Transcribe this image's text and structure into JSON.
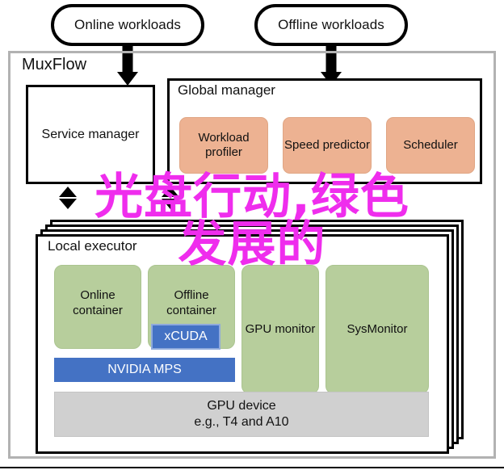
{
  "figure": {
    "outer_container": {
      "label": "MuxFlow",
      "border_color": "#b2b2b2"
    },
    "watermark": {
      "text": "光盘行动,绿色\n发展的",
      "color": "#ef2ded"
    }
  },
  "workloads": [
    {
      "id": "online-workloads",
      "label": "Online workloads"
    },
    {
      "id": "offline-workloads",
      "label": "Offline workloads"
    }
  ],
  "service_manager": {
    "label": "Service manager"
  },
  "global_manager": {
    "label": "Global manager",
    "accent_color": "#edb292",
    "components": [
      {
        "id": "workload-profiler",
        "label": "Workload profiler"
      },
      {
        "id": "speed-predictor",
        "label": "Speed predictor"
      },
      {
        "id": "scheduler",
        "label": "Scheduler"
      }
    ]
  },
  "local_executor": {
    "label": "Local executor",
    "accent_color": "#b7ce9c",
    "stack_layers": 4,
    "containers": [
      {
        "id": "online-container",
        "label": "Online container"
      },
      {
        "id": "offline-container",
        "label": "Offline container"
      },
      {
        "id": "gpu-monitor",
        "label": "GPU monitor"
      },
      {
        "id": "sysmonitor",
        "label": "SysMonitor"
      }
    ],
    "xcuda": {
      "label": "xCUDA",
      "color": "#4472c4"
    },
    "mps": {
      "label": "NVIDIA MPS",
      "color": "#4472c4"
    },
    "gpu_device": {
      "line1": "GPU device",
      "line2": "e.g., T4 and A10",
      "color": "#d0d0d0"
    }
  }
}
